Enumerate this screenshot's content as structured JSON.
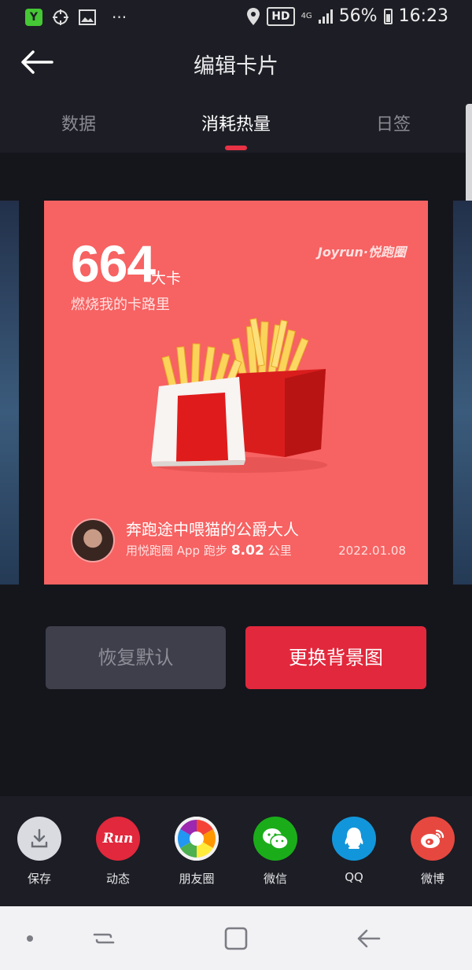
{
  "status_bar": {
    "app_badge": "Y",
    "hd": "HD",
    "network": "4G",
    "battery": "56%",
    "time": "16:23",
    "dots": "···"
  },
  "header": {
    "title": "编辑卡片",
    "tabs": [
      {
        "label": "数据"
      },
      {
        "label": "消耗热量"
      },
      {
        "label": "日签"
      }
    ],
    "active_tab": "消耗热量"
  },
  "card": {
    "calories": "664",
    "unit": "大卡",
    "description": "燃烧我的卡路里",
    "brand": "Joyrun·悦跑圈",
    "user_name": "奔跑途中喂猫的公爵大人",
    "run_prefix": "用悦跑圈 App 跑步",
    "distance": "8.02",
    "distance_unit": "公里",
    "date": "2022.01.08",
    "background_color": "#f76262"
  },
  "buttons": {
    "reset": "恢复默认",
    "change_background": "更换背景图"
  },
  "share": [
    {
      "label": "保存",
      "icon": "download-icon",
      "color": "#d9dbe0"
    },
    {
      "label": "动态",
      "icon": "run-logo-icon",
      "color": "#e2283c",
      "glyph": "Run"
    },
    {
      "label": "朋友圈",
      "icon": "aperture-icon",
      "color": "#ffffff"
    },
    {
      "label": "微信",
      "icon": "wechat-icon",
      "color": "#1aad19"
    },
    {
      "label": "QQ",
      "icon": "qq-penguin-icon",
      "color": "#1296db"
    },
    {
      "label": "微博",
      "icon": "weibo-icon",
      "color": "#e6483f"
    }
  ],
  "colors": {
    "accent": "#e2283c",
    "header_bg": "#1d1e25",
    "page_bg": "#15161c"
  }
}
